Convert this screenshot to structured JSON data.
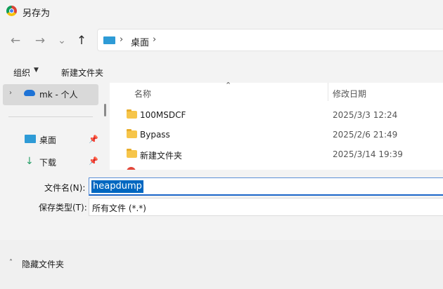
{
  "window": {
    "title": "另存为"
  },
  "nav": {
    "back_icon": "←",
    "forward_icon": "→",
    "recent_icon": "⌄",
    "up_icon": "↑",
    "address_separator": "›",
    "address_location": "桌面"
  },
  "toolbar": {
    "organize_label": "组织",
    "organize_arrow": "▼",
    "new_folder_label": "新建文件夹"
  },
  "sidebar": {
    "expand_icon": "›",
    "onedrive_label": "mk - 个人",
    "desktop_label": "桌面",
    "downloads_label": "下载",
    "pin_icon": "📌",
    "download_icon": "↓"
  },
  "list": {
    "sort_icon": "⌃",
    "columns": {
      "name": "名称",
      "date": "修改日期"
    },
    "items": [
      {
        "name": "100MSDCF",
        "date": "2025/3/3 12:24"
      },
      {
        "name": "Bypass",
        "date": "2025/2/6 21:49"
      },
      {
        "name": "新建文件夹",
        "date": "2025/3/14 19:39"
      }
    ]
  },
  "form": {
    "filename_label": "文件名(N):",
    "filename_value": "heapdump",
    "type_label": "保存类型(T):",
    "type_value": "所有文件 (*.*)"
  },
  "footer": {
    "hide_caret": "˄",
    "hide_folders_label": "隐藏文件夹"
  },
  "colors": {
    "accent": "#0067c0",
    "folder": "#f6c54a",
    "selection_bg": "#d9d9d9"
  }
}
